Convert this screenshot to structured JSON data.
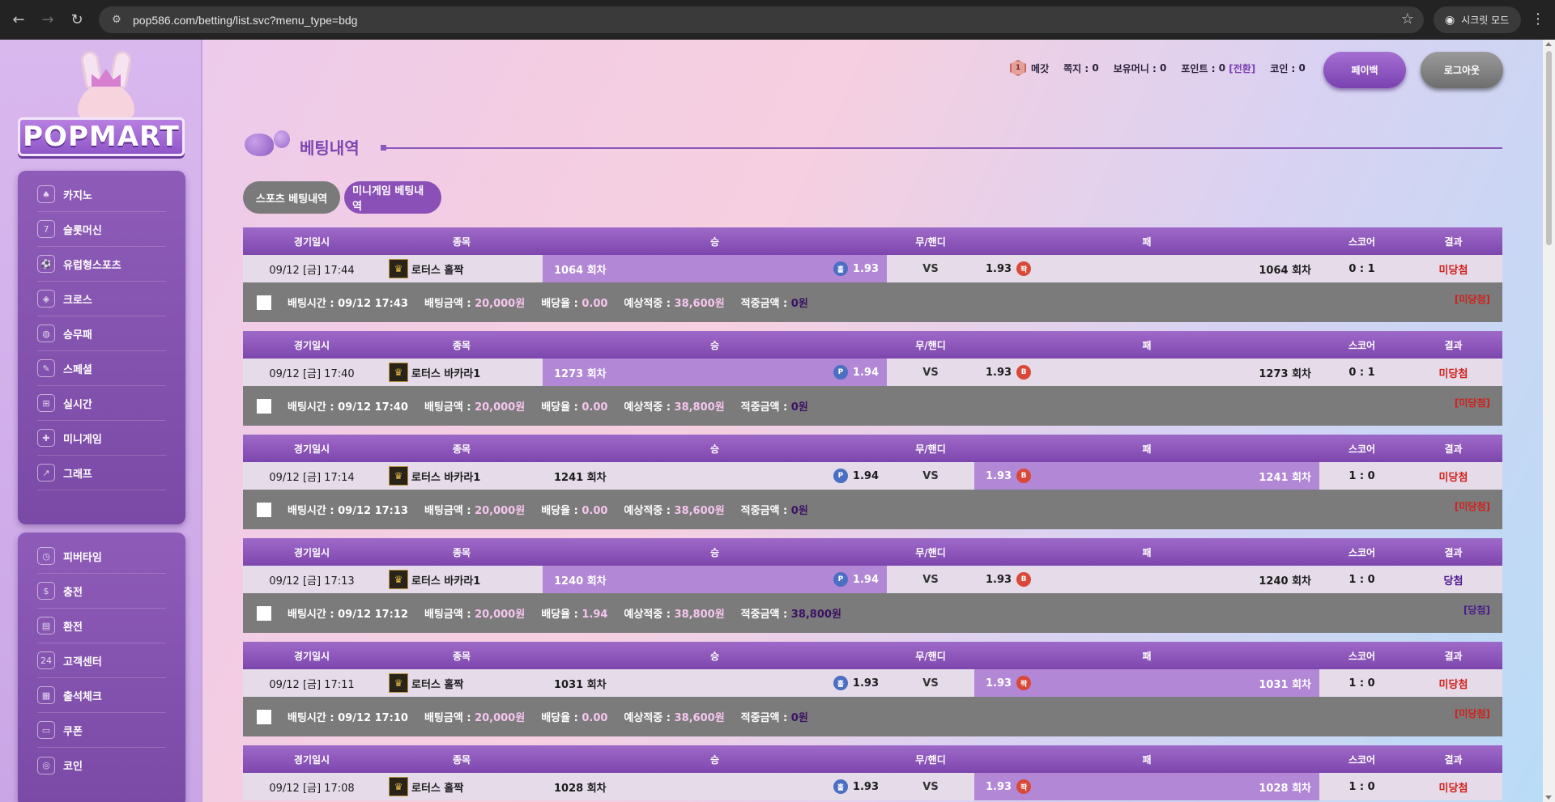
{
  "browser": {
    "url": "pop586.com/betting/list.svc?menu_type=bdg",
    "incognito_label": "시크릿 모드"
  },
  "logo": {
    "text": "POPMART"
  },
  "sidebar": {
    "primary": [
      {
        "label": "카지노",
        "icon": "casino-icon"
      },
      {
        "label": "슬롯머신",
        "icon": "slot-machine-icon"
      },
      {
        "label": "유럽형스포츠",
        "icon": "soccer-ball-icon"
      },
      {
        "label": "크로스",
        "icon": "football-icon"
      },
      {
        "label": "승무패",
        "icon": "volleyball-icon"
      },
      {
        "label": "스페셜",
        "icon": "badminton-icon"
      },
      {
        "label": "실시간",
        "icon": "basketball-hoop-icon"
      },
      {
        "label": "미니게임",
        "icon": "gamepad-icon"
      },
      {
        "label": "그래프",
        "icon": "chart-icon"
      }
    ],
    "secondary": [
      {
        "label": "피버타임",
        "icon": "clock-icon"
      },
      {
        "label": "충전",
        "icon": "dollar-coin-icon"
      },
      {
        "label": "환전",
        "icon": "wallet-icon"
      },
      {
        "label": "고객센터",
        "icon": "support-24-icon"
      },
      {
        "label": "출석체크",
        "icon": "calendar-icon"
      },
      {
        "label": "쿠폰",
        "icon": "coupon-icon"
      },
      {
        "label": "코인",
        "icon": "coin-icon"
      }
    ]
  },
  "header": {
    "level_badge": "1",
    "username": "메갓",
    "note_label": "쪽지 :",
    "note_value": "0",
    "money_label": "보유머니 :",
    "money_value": "0",
    "point_label": "포인트 :",
    "point_value": "0",
    "point_convert": "[전환]",
    "coin_label": "코인 :",
    "coin_value": "0",
    "payback_label": "페이백",
    "logout_label": "로그아웃"
  },
  "page": {
    "title": "베팅내역",
    "tabs": [
      "스포츠 베팅내역",
      "미니게임 베팅내역"
    ]
  },
  "columns": {
    "date": "경기일시",
    "game": "종목",
    "win": "승",
    "draw": "무/핸디",
    "lose": "패",
    "score": "스코어",
    "result": "결과"
  },
  "info_labels": {
    "bet_time": "배팅시간 :",
    "bet_amount": "배팅금액 :",
    "odds": "배당율 :",
    "expected": "예상적중 :",
    "hit_amount": "적중금액 :"
  },
  "bets": [
    {
      "date": "09/12 [금] 17:44",
      "game": "로터스 홀짝",
      "win_round": "1064 회차",
      "win_chip": "홀",
      "win_odds": "1.93",
      "draw": "VS",
      "lose_odds": "1.93",
      "lose_chip": "짝",
      "lose_round": "1064 회차",
      "selected": "win",
      "win_chip_color": "blue",
      "lose_chip_color": "red",
      "score": "0 : 1",
      "result": "미당첨",
      "result_type": "lose",
      "bet_time": "09/12 17:43",
      "bet_amount": "20,000원",
      "odds": "0.00",
      "expected": "38,600원",
      "hit_amount": "0원",
      "tag": "[미당첨]"
    },
    {
      "date": "09/12 [금] 17:40",
      "game": "로터스 바카라1",
      "win_round": "1273 회차",
      "win_chip": "P",
      "win_odds": "1.94",
      "draw": "VS",
      "lose_odds": "1.93",
      "lose_chip": "B",
      "lose_round": "1273 회차",
      "selected": "win",
      "win_chip_color": "blue",
      "lose_chip_color": "red",
      "score": "0 : 1",
      "result": "미당첨",
      "result_type": "lose",
      "bet_time": "09/12 17:40",
      "bet_amount": "20,000원",
      "odds": "0.00",
      "expected": "38,800원",
      "hit_amount": "0원",
      "tag": "[미당첨]"
    },
    {
      "date": "09/12 [금] 17:14",
      "game": "로터스 바카라1",
      "win_round": "1241 회차",
      "win_chip": "P",
      "win_odds": "1.94",
      "draw": "VS",
      "lose_odds": "1.93",
      "lose_chip": "B",
      "lose_round": "1241 회차",
      "selected": "lose",
      "win_chip_color": "blue",
      "lose_chip_color": "red",
      "score": "1 : 0",
      "result": "미당첨",
      "result_type": "lose",
      "bet_time": "09/12 17:13",
      "bet_amount": "20,000원",
      "odds": "0.00",
      "expected": "38,600원",
      "hit_amount": "0원",
      "tag": "[미당첨]"
    },
    {
      "date": "09/12 [금] 17:13",
      "game": "로터스 바카라1",
      "win_round": "1240 회차",
      "win_chip": "P",
      "win_odds": "1.94",
      "draw": "VS",
      "lose_odds": "1.93",
      "lose_chip": "B",
      "lose_round": "1240 회차",
      "selected": "win",
      "win_chip_color": "blue",
      "lose_chip_color": "red",
      "score": "1 : 0",
      "result": "당첨",
      "result_type": "win",
      "bet_time": "09/12 17:12",
      "bet_amount": "20,000원",
      "odds": "1.94",
      "expected": "38,800원",
      "hit_amount": "38,800원",
      "tag": "[당첨]"
    },
    {
      "date": "09/12 [금] 17:11",
      "game": "로터스 홀짝",
      "win_round": "1031 회차",
      "win_chip": "홀",
      "win_odds": "1.93",
      "draw": "VS",
      "lose_odds": "1.93",
      "lose_chip": "짝",
      "lose_round": "1031 회차",
      "selected": "lose",
      "win_chip_color": "blue",
      "lose_chip_color": "red",
      "score": "1 : 0",
      "result": "미당첨",
      "result_type": "lose",
      "bet_time": "09/12 17:10",
      "bet_amount": "20,000원",
      "odds": "0.00",
      "expected": "38,600원",
      "hit_amount": "0원",
      "tag": "[미당첨]"
    },
    {
      "date": "09/12 [금] 17:08",
      "game": "로터스 홀짝",
      "win_round": "1028 회차",
      "win_chip": "홀",
      "win_odds": "1.93",
      "draw": "VS",
      "lose_odds": "1.93",
      "lose_chip": "짝",
      "lose_round": "1028 회차",
      "selected": "lose",
      "win_chip_color": "blue",
      "lose_chip_color": "red",
      "score": "1 : 0",
      "result": "미당첨",
      "result_type": "lose"
    }
  ]
}
